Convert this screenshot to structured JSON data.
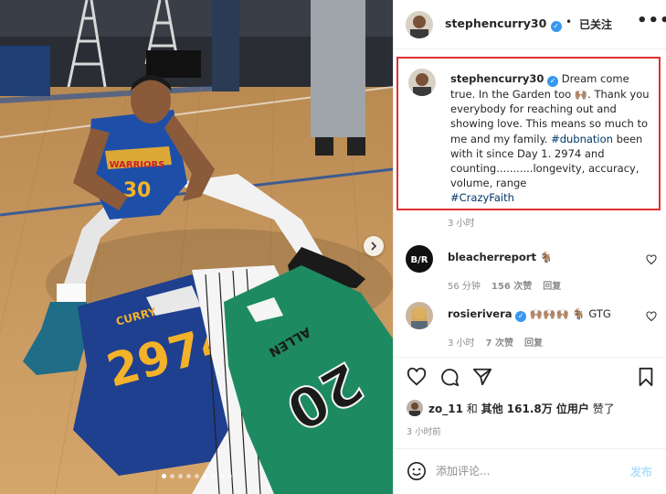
{
  "post": {
    "username": "stephencurry30",
    "follow_status": "已关注",
    "more": "•••",
    "caption_parts": {
      "before_tag": "Dream come true. In the Garden too 🙌🏽. Thank you everybody for reaching out and showing love. This means so much to me and my family. ",
      "tag1": "#dubnation",
      "after_tag": " been with it since Day 1. 2974 and counting...........longevity, accuracy, volume, range",
      "tag2": "#CrazyFaith"
    },
    "caption_time": "3 小时",
    "slide_count": 9,
    "active_slide": 0
  },
  "comments": [
    {
      "username": "bleacherreport",
      "text": "🐐",
      "time": "56 分钟",
      "likes": "156 次赞",
      "reply": "回复"
    },
    {
      "username": "rosierivera",
      "text": "🙌🏽🙌🏽🙌🏽 🐐 GTG",
      "time": "3 小时",
      "likes": "7 次赞",
      "reply": "回复"
    }
  ],
  "likes": {
    "user": "zo_11",
    "and": "和",
    "others": "其他 161.8万 位用户",
    "suffix": "赞了"
  },
  "post_time": "3 小时前",
  "comment_input": {
    "placeholder": "添加评论...",
    "post_label": "发布"
  },
  "photo_text": {
    "left_jersey_name": "CURRY",
    "left_jersey_number": "2974",
    "right_jersey_name": "ALLEN",
    "right_jersey_number": "20",
    "curry_jersey_team": "WARRIORS",
    "curry_jersey_number": "30"
  },
  "colors": {
    "verified": "#3897f0",
    "hashtag": "#00376b",
    "highlight_border": "#e03030",
    "post_button": "#b2dffc"
  }
}
